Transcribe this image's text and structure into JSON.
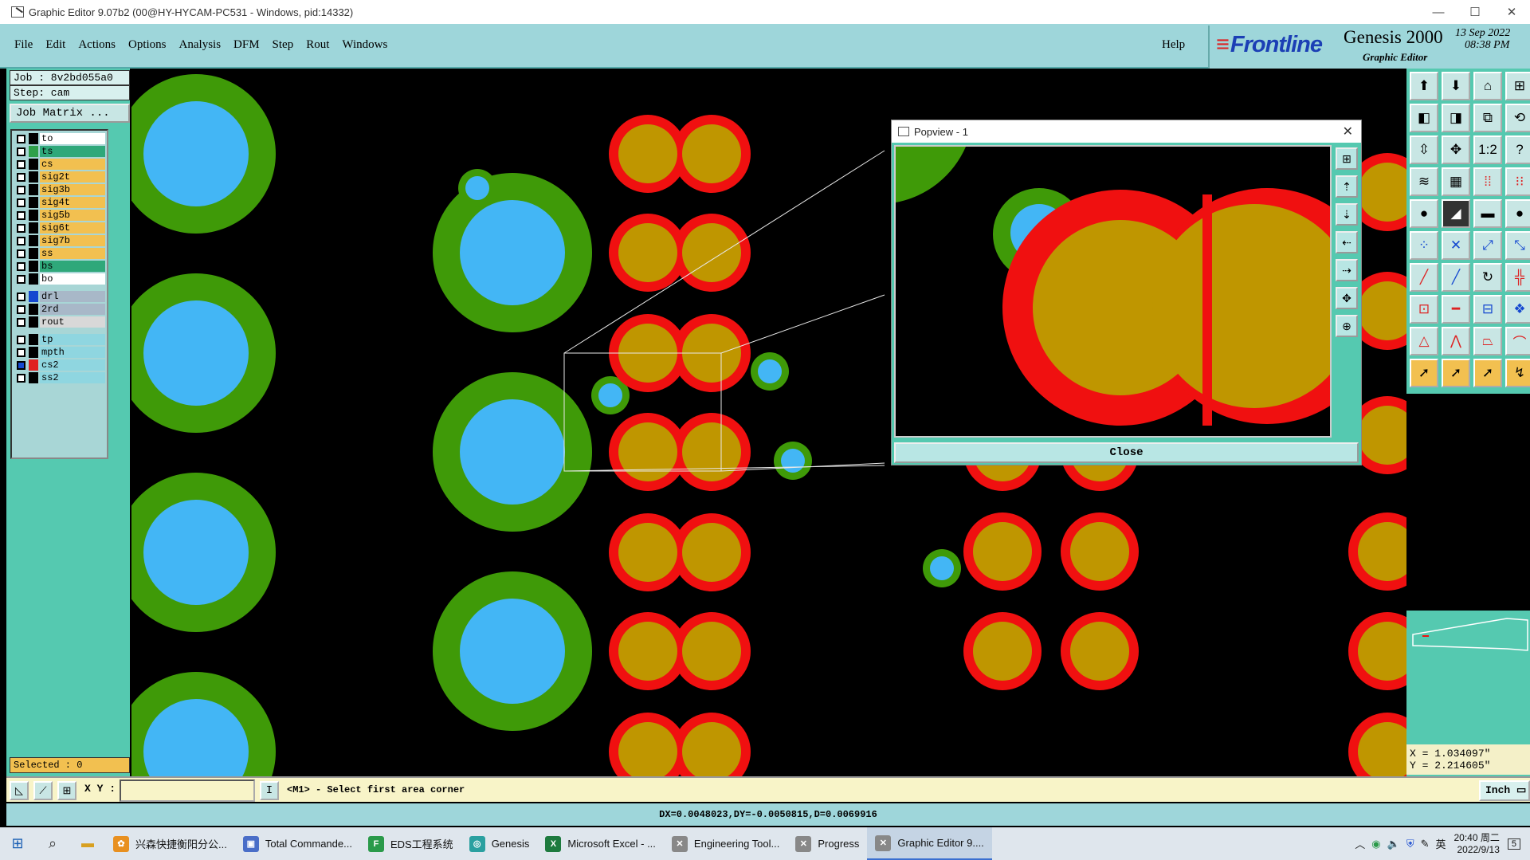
{
  "window": {
    "title": "Graphic Editor 9.07b2 (00@HY-HYCAM-PC531 - Windows, pid:14332)",
    "controls": [
      "—",
      "☐",
      "✕"
    ]
  },
  "menu": {
    "items": [
      "File",
      "Edit",
      "Actions",
      "Options",
      "Analysis",
      "DFM",
      "Step",
      "Rout",
      "Windows"
    ],
    "help": "Help"
  },
  "brand": {
    "logo": "Frontline",
    "product": "Genesis 2000",
    "subtitle": "Graphic Editor",
    "date": "13 Sep 2022",
    "time": "08:38 PM"
  },
  "left": {
    "job": "Job : 8v2bd055a0",
    "step": "Step: cam",
    "job_matrix": "Job Matrix ...",
    "layers": [
      {
        "name": "to",
        "color": "#ffffff",
        "swatch": "#000000"
      },
      {
        "name": "ts",
        "color": "#2fa87a",
        "swatch": "#2fa04a"
      },
      {
        "name": "cs",
        "color": "#f2c050",
        "swatch": "#000000"
      },
      {
        "name": "sig2t",
        "color": "#f2c050",
        "swatch": "#000000"
      },
      {
        "name": "sig3b",
        "color": "#f2c050",
        "swatch": "#000000"
      },
      {
        "name": "sig4t",
        "color": "#f2c050",
        "swatch": "#000000"
      },
      {
        "name": "sig5b",
        "color": "#f2c050",
        "swatch": "#000000"
      },
      {
        "name": "sig6t",
        "color": "#f2c050",
        "swatch": "#000000"
      },
      {
        "name": "sig7b",
        "color": "#f2c050",
        "swatch": "#000000"
      },
      {
        "name": "ss",
        "color": "#f2c050",
        "swatch": "#000000"
      },
      {
        "name": "bs",
        "color": "#2fa87a",
        "swatch": "#000000"
      },
      {
        "name": "bo",
        "color": "#ffffff",
        "swatch": "#000000"
      },
      {
        "name": "drl",
        "color": "#a8b8c8",
        "swatch": "#1448d0",
        "gap": true
      },
      {
        "name": "2rd",
        "color": "#a8b8c8",
        "swatch": "#000000"
      },
      {
        "name": "rout",
        "color": "#d8d8d8",
        "swatch": "#000000"
      },
      {
        "name": "tp",
        "color": "#8fd6e0",
        "swatch": "#000000",
        "gap": true
      },
      {
        "name": "mpth",
        "color": "#8fd6e0",
        "swatch": "#000000"
      },
      {
        "name": "cs2",
        "color": "#8fd6e0",
        "swatch": "#e02020",
        "checked": true
      },
      {
        "name": "ss2",
        "color": "#8fd6e0",
        "swatch": "#000000"
      }
    ],
    "selected": "Selected : 0"
  },
  "popview": {
    "title": "Popview - 1",
    "close_label": "Close"
  },
  "coords": {
    "x": "X = 1.034097\"",
    "y": "Y = 2.214605\""
  },
  "command": {
    "xy_label": "X Y :",
    "xy_value": "",
    "info_button": "I",
    "message": "<M1> - Select first area corner",
    "unit": "Inch"
  },
  "status": "DX=0.0048023,DY=-0.0050815,D=0.0069916",
  "taskbar": {
    "apps": [
      {
        "label": "兴森快捷衡阳分公...",
        "color": "#e89020",
        "icon": "✿"
      },
      {
        "label": "Total Commande...",
        "color": "#4a6ec8",
        "icon": "▣"
      },
      {
        "label": "EDS工程系统",
        "color": "#2a9a4a",
        "icon": "F"
      },
      {
        "label": "Genesis",
        "color": "#2aa0a0",
        "icon": "◎"
      },
      {
        "label": "Microsoft Excel - ...",
        "color": "#1d7a3e",
        "icon": "X"
      },
      {
        "label": "Engineering Tool...",
        "color": "#888888",
        "icon": "✕"
      },
      {
        "label": "Progress",
        "color": "#888888",
        "icon": "✕"
      },
      {
        "label": "Graphic Editor 9....",
        "color": "#888888",
        "icon": "✕",
        "active": true
      }
    ],
    "tray_ime": "英",
    "clock_time": "20:40 周二",
    "clock_date": "2022/9/13",
    "notif": "5"
  },
  "colors": {
    "pad_red": "#f01010",
    "pad_gold": "#bf9600",
    "via_green": "#3f9a08",
    "drill_blue": "#43b6f5"
  }
}
